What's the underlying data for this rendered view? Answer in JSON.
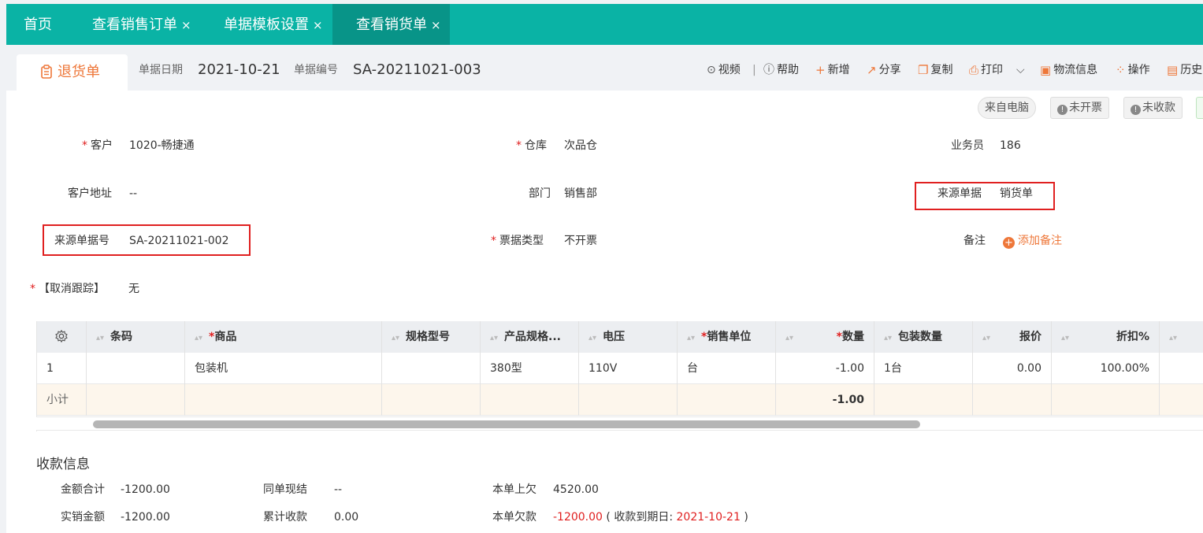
{
  "tabs": [
    {
      "label": "首页",
      "closable": false
    },
    {
      "label": "查看销售订单",
      "closable": true
    },
    {
      "label": "单据模板设置",
      "closable": true
    },
    {
      "label": "查看销货单",
      "closable": true,
      "active": true
    }
  ],
  "tab_close_glyph": "×",
  "doc": {
    "type_label": "退货单",
    "date_label": "单据日期",
    "date_value": "2021-10-21",
    "no_label": "单据编号",
    "no_value": "SA-20211021-003"
  },
  "toolbar": {
    "video": "视频",
    "sep": "|",
    "help": "帮助",
    "add": "新增",
    "share": "分享",
    "copy": "复制",
    "print": "打印",
    "logistics": "物流信息",
    "operate": "操作",
    "history": "历史"
  },
  "chips": {
    "source_device": "来自电脑",
    "invoice_status": "未开票",
    "payment_status": "未收款"
  },
  "form": {
    "customer_label": "客户",
    "customer_value": "1020-畅捷通",
    "warehouse_label": "仓库",
    "warehouse_value": "次品仓",
    "salesman_label": "业务员",
    "salesman_value": "186",
    "address_label": "客户地址",
    "address_value": "--",
    "dept_label": "部门",
    "dept_value": "销售部",
    "source_doc_label": "来源单据",
    "source_doc_value": "销货单",
    "source_no_label": "来源单据号",
    "source_no_value": "SA-20211021-002",
    "invoice_type_label": "票据类型",
    "invoice_type_value": "不开票",
    "remark_label": "备注",
    "remark_add": "添加备注",
    "cancel_track_label": "【取消跟踪】",
    "cancel_track_value": "无",
    "required_mark": "*"
  },
  "table": {
    "columns": [
      "条码",
      "商品",
      "规格型号",
      "产品规格...",
      "电压",
      "销售单位",
      "数量",
      "包装数量",
      "报价",
      "折扣%"
    ],
    "row": [
      "1",
      "",
      "包装机",
      "",
      "380型",
      "110V",
      "台",
      "-1.00",
      "1台",
      "0.00",
      "100.00%"
    ],
    "subtotal_label": "小计",
    "subtotal_qty": "-1.00"
  },
  "payment": {
    "title": "收款信息",
    "total_label": "金额合计",
    "total_value": "-1200.00",
    "same_cash_label": "同单现结",
    "same_cash_value": "--",
    "prev_owe_label": "本单上欠",
    "prev_owe_value": "4520.00",
    "actual_label": "实销金额",
    "actual_value": "-1200.00",
    "accum_label": "累计收款",
    "accum_value": "0.00",
    "owe_label": "本单欠款",
    "owe_value": "-1200.00",
    "due_open": "( 收款到期日: ",
    "due_value": "2021-10-21",
    "due_close": " )"
  },
  "colors": {
    "tabbar": "#0ab3a5",
    "tab_active": "#089488",
    "accent": "#ee7739",
    "required": "#e02020",
    "highlight_box": "#e02020"
  }
}
